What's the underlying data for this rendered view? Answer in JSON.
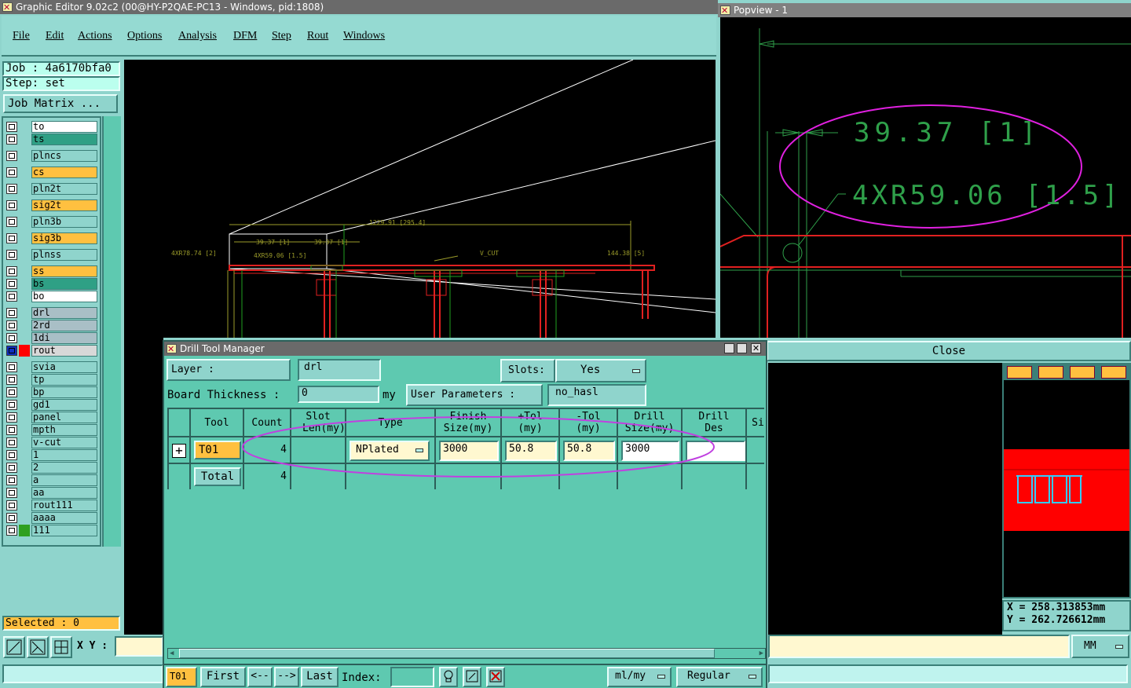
{
  "main_window": {
    "title": "Graphic Editor 9.02c2 (00@HY-P2QAE-PC13 - Windows, pid:1808)",
    "menu": [
      "File",
      "Edit",
      "Actions",
      "Options",
      "Analysis",
      "DFM",
      "Step",
      "Rout",
      "Windows"
    ],
    "job_label": "Job : 4a6170bfa0",
    "step_label": "Step: set",
    "job_matrix_button": "Job Matrix ...",
    "selected_label": "Selected : 0",
    "xy_label": "X Y :"
  },
  "layers": [
    {
      "name": "to",
      "color": "#ffffff"
    },
    {
      "name": "ts",
      "color": "#2fa085"
    },
    {
      "name": "plncs",
      "color": "#8fd4cc"
    },
    {
      "name": "cs",
      "color": "#ffc040"
    },
    {
      "name": "pln2t",
      "color": "#8fd4cc"
    },
    {
      "name": "sig2t",
      "color": "#ffc040"
    },
    {
      "name": "pln3b",
      "color": "#8fd4cc"
    },
    {
      "name": "sig3b",
      "color": "#ffc040"
    },
    {
      "name": "plnss",
      "color": "#8fd4cc"
    },
    {
      "name": "ss",
      "color": "#ffc040"
    },
    {
      "name": "bs",
      "color": "#2fa085"
    },
    {
      "name": "bo",
      "color": "#ffffff"
    },
    {
      "name": "drl",
      "color": "#a9bfc6"
    },
    {
      "name": "2rd",
      "color": "#a9bfc6"
    },
    {
      "name": "1di",
      "color": "#a9bfc6"
    },
    {
      "name": "rout",
      "color": "#d8d8d8"
    },
    {
      "name": "svia",
      "color": "#8fd4cc"
    },
    {
      "name": "tp",
      "color": "#8fd4cc"
    },
    {
      "name": "bp",
      "color": "#8fd4cc"
    },
    {
      "name": "gd1",
      "color": "#8fd4cc"
    },
    {
      "name": "panel",
      "color": "#8fd4cc"
    },
    {
      "name": "mpth",
      "color": "#8fd4cc"
    },
    {
      "name": "v-cut",
      "color": "#8fd4cc"
    },
    {
      "name": "1",
      "color": "#8fd4cc"
    },
    {
      "name": "2",
      "color": "#8fd4cc"
    },
    {
      "name": "a",
      "color": "#8fd4cc"
    },
    {
      "name": "aa",
      "color": "#8fd4cc"
    },
    {
      "name": "rout111",
      "color": "#8fd4cc"
    },
    {
      "name": "aaaa",
      "color": "#8fd4cc"
    },
    {
      "name": "111",
      "color": "#8fd4cc"
    }
  ],
  "canvas_annotations": {
    "dim_top": "1229.91 [295.4]",
    "dim_left": "4XR78.74 [2]",
    "dim_a": "39.37 [1]",
    "dim_b": "39.37 [1]",
    "dim_r": "4XR59.06 [1.5]",
    "vcut": "V_CUT",
    "dim_right": "144.38 [5]"
  },
  "popview": {
    "title": "Popview - 1",
    "dim1": "39.37 [1]",
    "dim2": "4XR59.06 [1.5]",
    "close_button": "Close",
    "x_readout": "X = 258.313853mm",
    "y_readout": "Y = 262.726612mm",
    "units": "MM"
  },
  "drill_tool_manager": {
    "title": "Drill Tool Manager",
    "layer_label": "Layer :",
    "layer_value": "drl",
    "slots_label": "Slots:",
    "slots_value": "Yes",
    "board_thickness_label": "Board Thickness :",
    "board_thickness_value": "0",
    "board_thickness_unit": "my",
    "user_parameters_label": "User Parameters :",
    "user_parameters_value": "no_hasl",
    "columns": [
      "Tool",
      "Count",
      "Slot Len(my)",
      "Type",
      "Finish Size(my)",
      "+Tol (my)",
      "-Tol (my)",
      "Drill Size(my)",
      "Drill Des",
      "Si"
    ],
    "row": {
      "tool": "T01",
      "count": "4",
      "type": "NPlated",
      "finish": "3000",
      "ptol": "50.8",
      "mtol": "50.8",
      "drill": "3000",
      "des": ""
    },
    "total_label": "Total",
    "total_count": "4",
    "footer": {
      "current_tool": "T01",
      "first": "First",
      "prev": "<--",
      "next": "-->",
      "last": "Last",
      "index_label": "Index:",
      "units": "ml/my",
      "mode": "Regular"
    }
  }
}
